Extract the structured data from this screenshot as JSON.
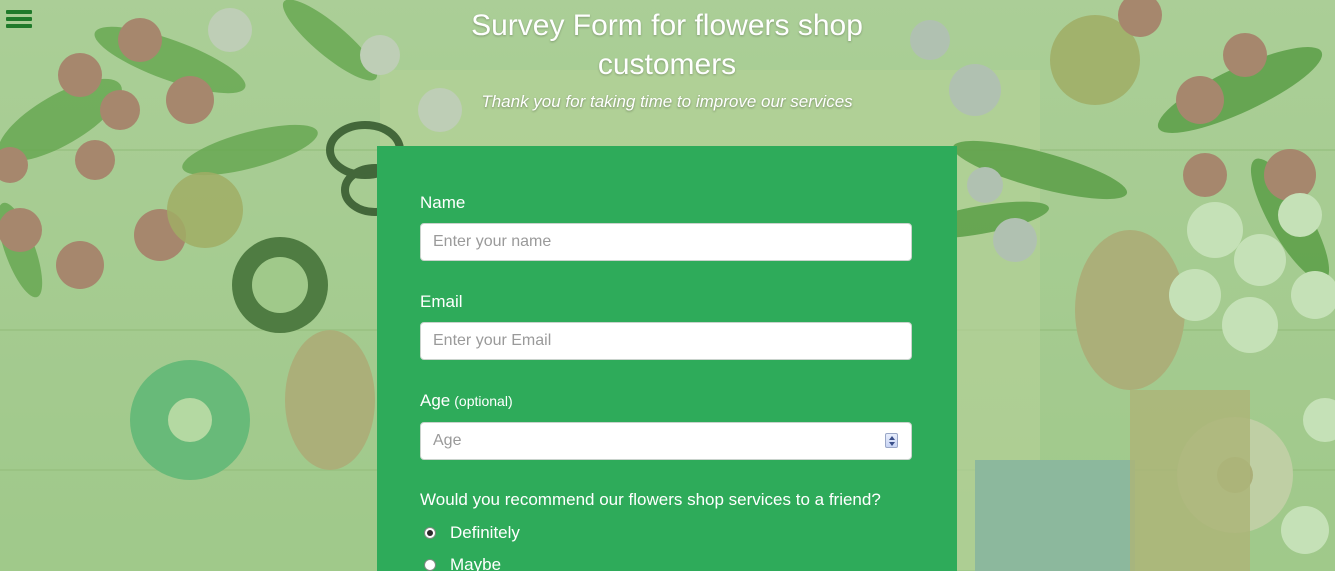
{
  "header": {
    "title": "Survey Form for flowers shop customers",
    "subtitle": "Thank you for taking time to improve our services"
  },
  "icons": {
    "menu": "hamburger-menu-icon"
  },
  "form": {
    "name": {
      "label": "Name",
      "placeholder": "Enter your name",
      "value": ""
    },
    "email": {
      "label": "Email",
      "placeholder": "Enter your Email",
      "value": ""
    },
    "age": {
      "label": "Age",
      "optional_note": "(optional)",
      "placeholder": "Age",
      "value": ""
    },
    "recommend": {
      "question": "Would you recommend our flowers shop services to a friend?",
      "options": [
        {
          "label": "Definitely",
          "checked": true
        },
        {
          "label": "Maybe",
          "checked": false
        }
      ]
    }
  },
  "colors": {
    "form_background": "#2eab5a",
    "overlay_green": "#74be5a",
    "menu_icon": "#1f7a2a"
  }
}
